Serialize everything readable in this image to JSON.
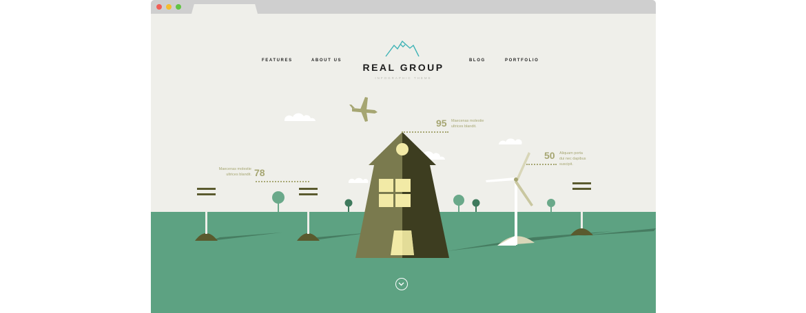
{
  "window": {
    "controls": [
      "close",
      "minimize",
      "maximize"
    ],
    "colors": {
      "close": "#f15f57",
      "minimize": "#f5bd2f",
      "maximize": "#62c444"
    }
  },
  "nav": {
    "left": [
      "FEATURES",
      "ABOUT US"
    ],
    "right": [
      "BLOG",
      "PORTFOLIO"
    ]
  },
  "brand": {
    "logo_icon": "mountain-icon",
    "title": "REAL GROUP",
    "subtitle": "INFOGRAPHIC THEME"
  },
  "stats": [
    {
      "value": "78",
      "text": "Maecenas molestie\nultrices blandit."
    },
    {
      "value": "95",
      "text": "Maecenas molestie\nultrices blandit."
    },
    {
      "value": "50",
      "text": "Aliquam porta\ndui nec dapibus\nsuscipit."
    }
  ],
  "scroll_icon": "chevron-down-icon",
  "colors": {
    "sky": "#efefea",
    "ground": "#5da282",
    "house_light": "#7a7a4e",
    "house_dark": "#3d3d20",
    "window": "#f2eaa6",
    "accent_text": "#a6a672",
    "logo": "#3fb3b6"
  }
}
